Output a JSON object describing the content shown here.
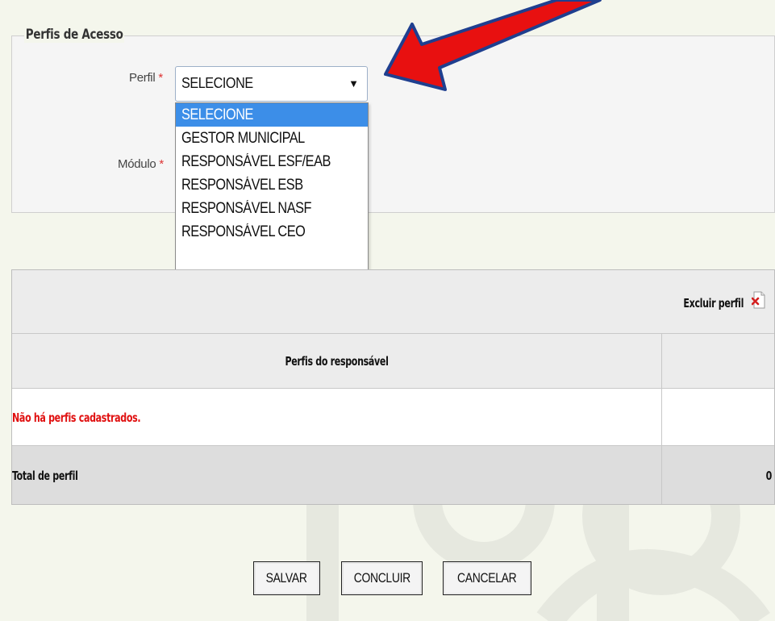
{
  "fieldset": {
    "legend": "Perfis de Acesso",
    "perfil_label": "Perfil",
    "modulo_label": "Módulo",
    "required_mark": "*"
  },
  "perfil_select": {
    "value": "SELECIONE",
    "arrow": "▼",
    "options": [
      "SELECIONE",
      "GESTOR MUNICIPAL",
      "RESPONSÁVEL ESF/EAB",
      "RESPONSÁVEL ESB",
      "RESPONSÁVEL NASF",
      "RESPONSÁVEL CEO"
    ],
    "selected_index": 0
  },
  "table": {
    "excluir_label": "Excluir perfil",
    "column_header": "Perfis do responsável",
    "empty_message": "Não há perfis cadastrados.",
    "total_label": "Total de perfil",
    "total_value": "0"
  },
  "buttons": {
    "salvar": "SALVAR",
    "concluir": "CONCLUIR",
    "cancelar": "CANCELAR"
  },
  "colors": {
    "annotation_arrow": "#e81010",
    "annotation_arrow_outline": "#1f3f8f",
    "selected_option": "#3c8ee8",
    "empty_message": "#e01010",
    "required_mark": "#dd3333"
  },
  "icons": {
    "excluir": "delete-file-icon",
    "dropdown": "chevron-down-icon",
    "annotation": "pointer-arrow-icon"
  }
}
